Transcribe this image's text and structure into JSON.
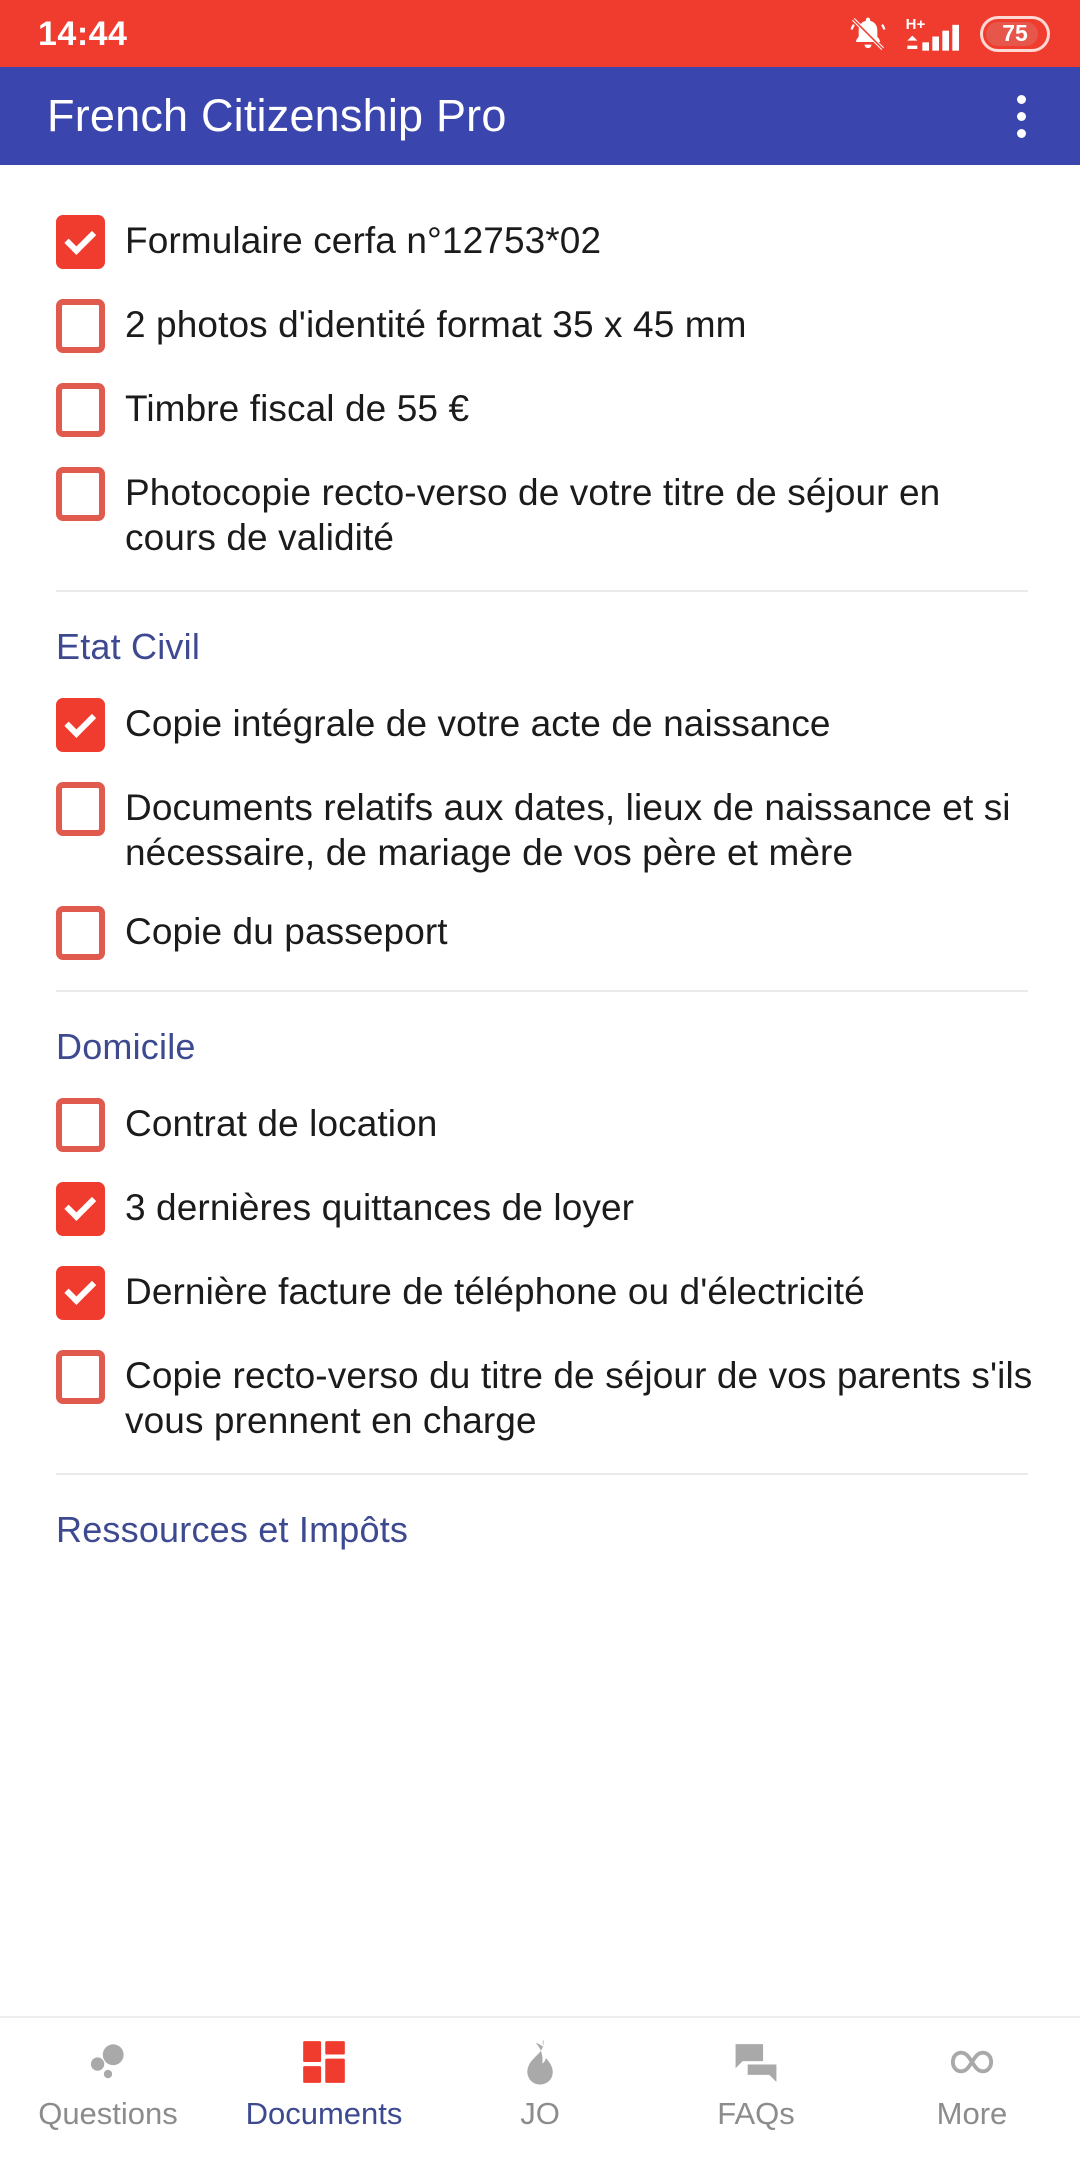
{
  "status_bar": {
    "time": "14:44",
    "battery_percent": "75",
    "network_type": "H+",
    "icons": [
      "bell-muted-icon",
      "signal-bars-icon",
      "battery-icon"
    ]
  },
  "app_bar": {
    "title": "French Citizenship Pro",
    "overflow_menu": "overflow-menu-icon"
  },
  "colors": {
    "status_bar_bg": "#f03c2e",
    "app_bar_bg": "#3a45ae",
    "checkbox_accent": "#f03c2e",
    "checkbox_outline": "#e05a4d",
    "section_title": "#3d4a90",
    "nav_inactive": "#8c8c8c",
    "nav_active": "#3d4a90"
  },
  "checklist": {
    "sections": [
      {
        "title": "",
        "items": [
          {
            "label": "Formulaire cerfa n°12753*02",
            "checked": true
          },
          {
            "label": "2 photos d'identité format 35 x 45 mm",
            "checked": false
          },
          {
            "label": "Timbre fiscal de 55 €",
            "checked": false
          },
          {
            "label": "Photocopie recto-verso de votre titre de séjour en cours de validité",
            "checked": false
          }
        ]
      },
      {
        "title": "Etat Civil",
        "items": [
          {
            "label": "Copie intégrale de votre acte de naissance",
            "checked": true
          },
          {
            "label": "Documents relatifs aux dates, lieux de naissance et si nécessaire, de mariage de vos père et mère",
            "checked": false
          },
          {
            "label": "Copie du passeport",
            "checked": false
          }
        ]
      },
      {
        "title": "Domicile",
        "items": [
          {
            "label": "Contrat de location",
            "checked": false
          },
          {
            "label": "3 dernières quittances de loyer",
            "checked": true
          },
          {
            "label": "Dernière facture de téléphone ou d'électricité",
            "checked": true
          },
          {
            "label": "Copie recto-verso du titre de séjour de vos parents s'ils vous prennent en charge",
            "checked": false
          }
        ]
      },
      {
        "title": "Ressources et Impôts",
        "items": []
      }
    ]
  },
  "bottom_nav": {
    "items": [
      {
        "label": "Questions",
        "icon": "bubbles-icon",
        "active": false
      },
      {
        "label": "Documents",
        "icon": "grid-icon",
        "active": true
      },
      {
        "label": "JO",
        "icon": "flame-icon",
        "active": false
      },
      {
        "label": "FAQs",
        "icon": "chat-bubbles-icon",
        "active": false
      },
      {
        "label": "More",
        "icon": "infinity-icon",
        "active": false
      }
    ]
  }
}
